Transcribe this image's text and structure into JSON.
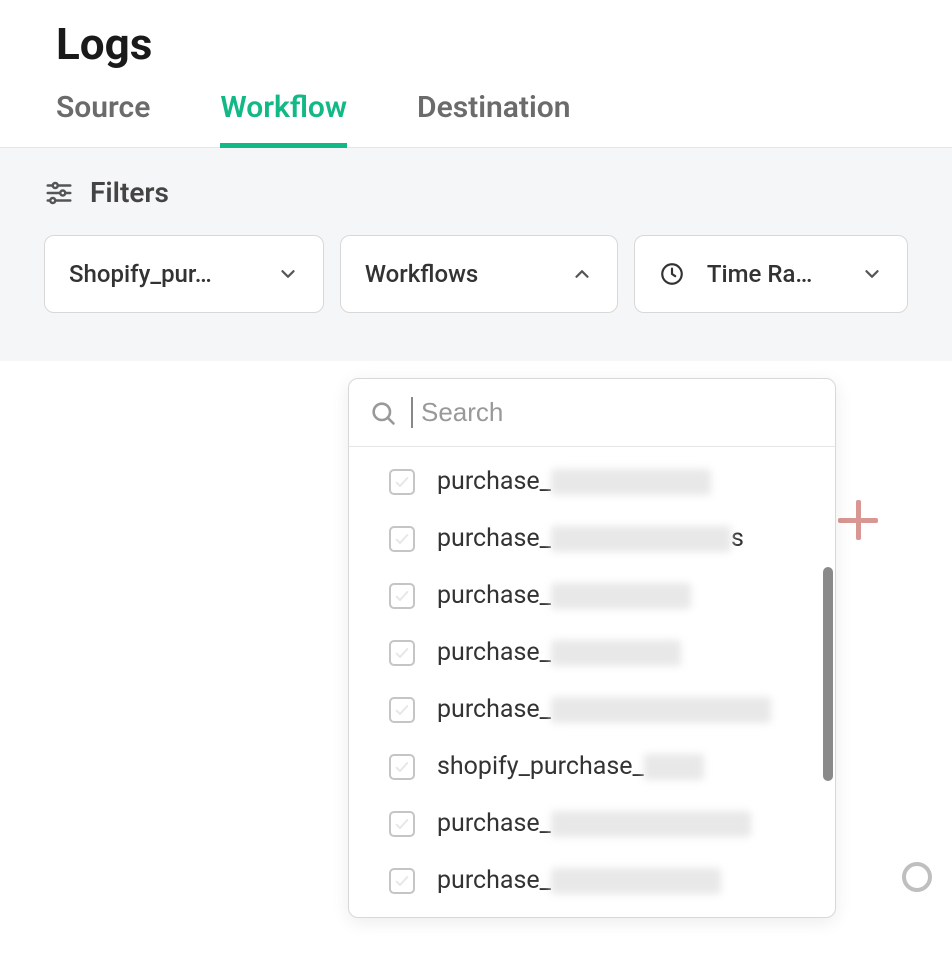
{
  "page_title": "Logs",
  "tabs": [
    {
      "label": "Source"
    },
    {
      "label": "Workflow",
      "active": true
    },
    {
      "label": "Destination"
    }
  ],
  "filters": {
    "heading": "Filters",
    "source_pill": "Shopify_pur…",
    "workflows_pill": "Workflows",
    "time_pill": "Time Ra…"
  },
  "dropdown": {
    "search_placeholder": "Search",
    "items": [
      {
        "prefix": "purchase_",
        "blur_width": "bw-160"
      },
      {
        "prefix": "purchase_",
        "blur_width": "bw-180",
        "suffix": "s"
      },
      {
        "prefix": "purchase_",
        "blur_width": "bw-140"
      },
      {
        "prefix": "purchase_",
        "blur_width": "bw-130"
      },
      {
        "prefix": "purchase_",
        "blur_width": "bw-220"
      },
      {
        "prefix": "shopify_purchase_",
        "blur_width": "bw-60"
      },
      {
        "prefix": "purchase_",
        "blur_width": "bw-200"
      },
      {
        "prefix": "purchase_",
        "blur_width": "bw-170"
      }
    ]
  }
}
